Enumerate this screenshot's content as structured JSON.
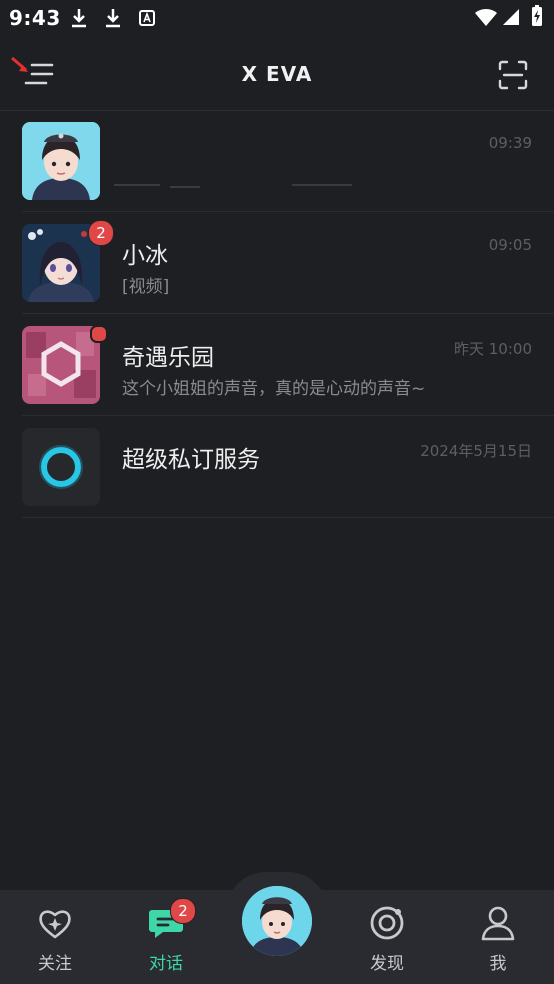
{
  "status_bar": {
    "time": "9:43"
  },
  "header": {
    "title": "X EVA"
  },
  "conversations": [
    {
      "name": "",
      "message": "",
      "time": "09:39"
    },
    {
      "name": "小冰",
      "message": "[视频]",
      "time": "09:05",
      "badge": "2"
    },
    {
      "name": "奇遇乐园",
      "message": "这个小姐姐的声音，真的是心动的声音~",
      "time": "昨天 10:00"
    },
    {
      "name": "超级私订服务",
      "message": "",
      "time": "2024年5月15日"
    }
  ],
  "bottom_nav": {
    "items": [
      {
        "label": "关注",
        "icon": "heart-sparkle-icon"
      },
      {
        "label": "对话",
        "icon": "chat-bubble-icon",
        "badge": "2"
      },
      {
        "label": "",
        "icon": "avatar-center"
      },
      {
        "label": "发现",
        "icon": "discover-icon"
      },
      {
        "label": "我",
        "icon": "profile-icon"
      }
    ]
  },
  "colors": {
    "accent": "#3fd6a8",
    "badge": "#e04848",
    "background": "#1e1f23",
    "nav": "#2a2b30"
  }
}
